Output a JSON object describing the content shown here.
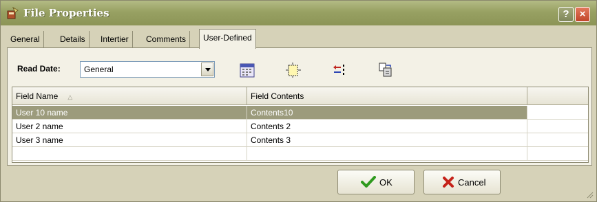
{
  "window": {
    "title": "File Properties",
    "help_label": "?",
    "close_label": "×"
  },
  "tabs": [
    {
      "label": "General"
    },
    {
      "label": "Details"
    },
    {
      "label": "Intertier"
    },
    {
      "label": "Comments"
    },
    {
      "label": "User-Defined"
    }
  ],
  "read_date": {
    "label": "Read Date:",
    "value": "General"
  },
  "toolbar": {
    "icons": [
      "calendar-icon",
      "new-field-icon",
      "move-icon",
      "paste-icon"
    ]
  },
  "grid": {
    "columns": [
      "Field Name",
      "Field Contents",
      ""
    ],
    "rows": [
      {
        "name": "User 10 name",
        "contents": "Contents10",
        "selected": true
      },
      {
        "name": "User 2 name",
        "contents": "Contents 2",
        "selected": false
      },
      {
        "name": "User 3 name",
        "contents": "Contents 3",
        "selected": false
      }
    ]
  },
  "buttons": {
    "ok_label": "OK",
    "cancel_label": "Cancel"
  },
  "colors": {
    "titlebar": "#98a163",
    "selection": "#9c9b7c"
  }
}
